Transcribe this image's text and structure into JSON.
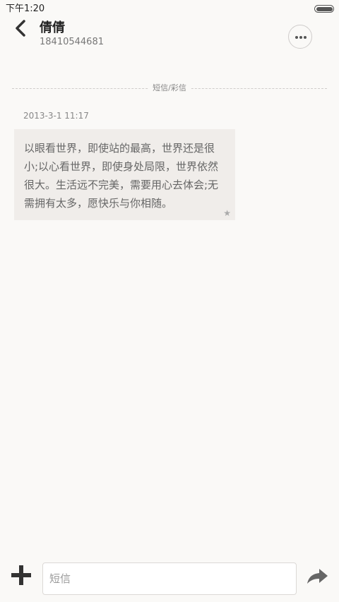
{
  "status_bar": {
    "time": "下午1:20"
  },
  "header": {
    "contact_name": "倩倩",
    "phone_number": "18410544681"
  },
  "conversation": {
    "divider_label": "短信/彩信",
    "messages": [
      {
        "timestamp": "2013-3-1 11:17",
        "text": "以眼看世界，即使站的最高，世界还是很小;以心看世界，即使身处局限，世界依然很大。生活远不完美，需要用心去体会;无需拥有太多，愿快乐与你相随。",
        "starred": true
      }
    ]
  },
  "input_bar": {
    "placeholder": "短信",
    "value": ""
  },
  "icons": {
    "back": "chevron-left-icon",
    "more": "more-horizontal-icon",
    "star": "star-icon",
    "add": "plus-icon",
    "send": "send-arrow-icon"
  }
}
